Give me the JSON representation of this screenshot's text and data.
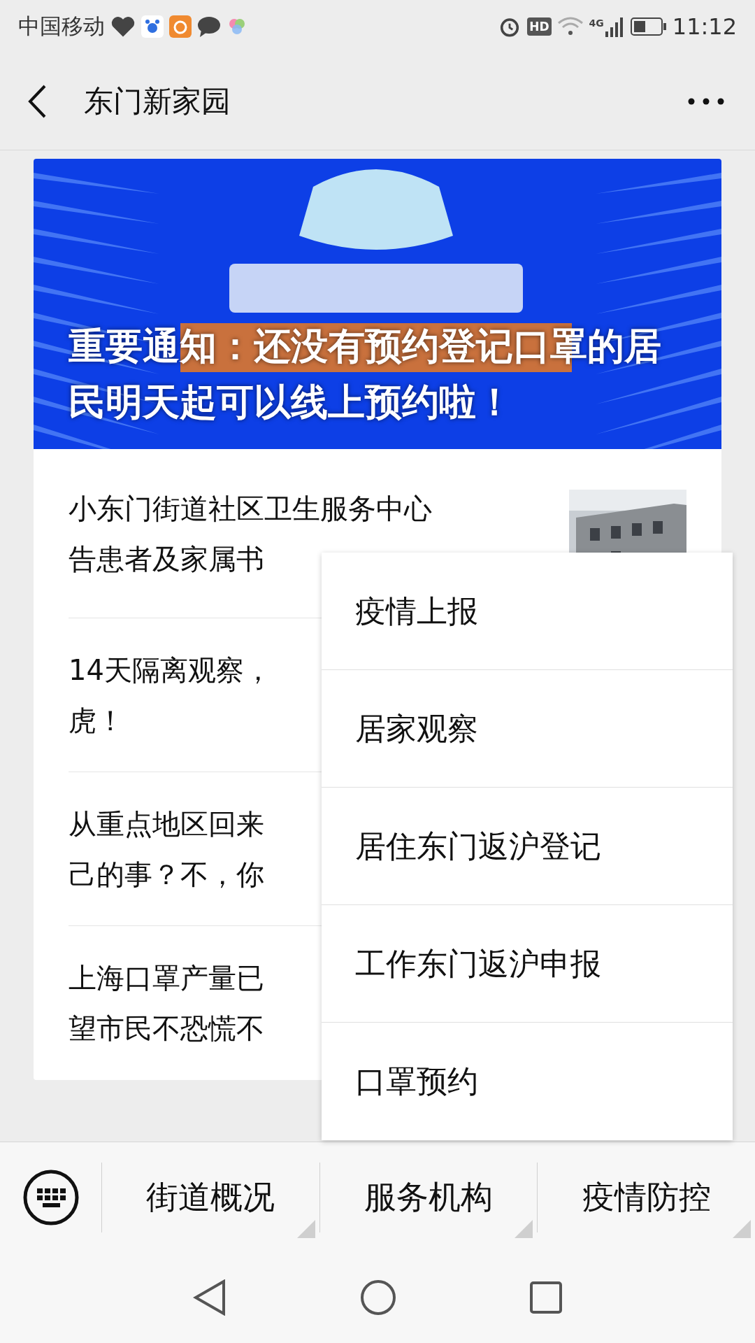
{
  "status_bar": {
    "carrier": "中国移动",
    "hd": "HD",
    "network": "4G",
    "time": "11:12"
  },
  "nav": {
    "title": "东门新家园"
  },
  "banner": {
    "kind": "picture",
    "caption": "重要通知：还没有预约登记口罩的居民明天起可以线上预约啦！"
  },
  "articles": [
    {
      "lines": [
        "小东门街道社区卫生服务中心",
        "告患者及家属书"
      ],
      "thumbnail": true
    },
    {
      "lines": [
        "14天隔离观察，",
        "虎！"
      ]
    },
    {
      "lines": [
        "从重点地区回来",
        "己的事？不，你"
      ]
    },
    {
      "lines": [
        "上海口罩产量已",
        "望市民不恐慌不"
      ]
    }
  ],
  "popup_menu": [
    "疫情上报",
    "居家观察",
    "居住东门返沪登记",
    "工作东门返沪申报",
    "口罩预约"
  ],
  "bottom_menu": [
    {
      "label": "街道概况"
    },
    {
      "label": "服务机构"
    },
    {
      "label": "疫情防控"
    }
  ]
}
